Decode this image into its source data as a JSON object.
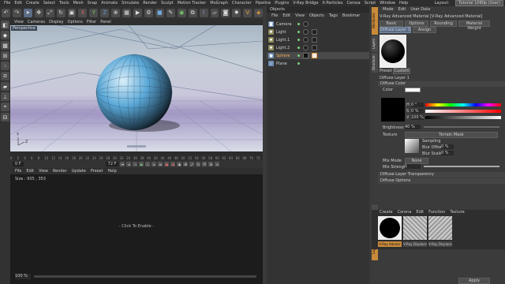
{
  "menubar": {
    "items": [
      "File",
      "Edit",
      "Create",
      "Select",
      "Tools",
      "Mesh",
      "Snap",
      "Animate",
      "Simulate",
      "Render",
      "Sculpt",
      "Motion Tracker",
      "MoGraph",
      "Character",
      "Pipeline",
      "Plugins",
      "V-Ray Bridge",
      "X-Particles",
      "Cerosa",
      "Script",
      "Window",
      "Help"
    ],
    "layout_label": "Layout:",
    "layout_value": "Tutorial 1080p (User)"
  },
  "viewport": {
    "menu": [
      "View",
      "Cameras",
      "Display",
      "Options",
      "Filter",
      "Panel"
    ],
    "label": "Perspective",
    "axis_y": "Y",
    "axis_z": "Z"
  },
  "timeline": {
    "ticks": [
      "0",
      "2",
      "4",
      "6",
      "8",
      "10",
      "12",
      "14",
      "16",
      "18",
      "20",
      "22",
      "24",
      "26",
      "28",
      "30",
      "32",
      "34",
      "36",
      "38",
      "40",
      "42",
      "44",
      "46",
      "48",
      "50",
      "52",
      "54",
      "56",
      "58",
      "60",
      "62",
      "64",
      "66",
      "68",
      "70",
      "72"
    ],
    "frame_start": "0 F",
    "frame_end": "72 F",
    "current": "0 F"
  },
  "picture_viewer": {
    "menu": [
      "File",
      "Edit",
      "View",
      "Render",
      "Update",
      "Preset",
      "Help"
    ],
    "size": "Size : 935 , 353",
    "placeholder": "- Click To Enable -",
    "zoom": "100 %"
  },
  "objects": {
    "title": "Objects",
    "menu": [
      "File",
      "Edit",
      "View",
      "Objects",
      "Tags",
      "Bookmar"
    ],
    "rows": [
      "Camera",
      "Light",
      "Light.1",
      "Light.2",
      "Sphere",
      "Plane"
    ]
  },
  "attributes": {
    "menu": [
      "Mode",
      "Edit",
      "User Data"
    ],
    "header": "V-Ray Advanced Material [V-Ray Advanced Material]",
    "tabs": [
      "Basic",
      "Options",
      "Rounding",
      "Material Weight"
    ],
    "subtabs": [
      "Diffuse Layer 1",
      "Assign"
    ],
    "preset_label": "Preset",
    "preset_value": "Custom",
    "layer_title": "Diffuse Layer 1",
    "diffuse_color": "Diffuse Color",
    "color_label": "Color",
    "h_label": "H",
    "h_value": "0 °",
    "s_label": "S",
    "s_value": "0 %",
    "v_label": "V",
    "v_value": "100 %",
    "brightness_label": "Brightness",
    "brightness_value": "40 %",
    "texture_label": "Texture",
    "texture_value": "Terrain Mask",
    "sampling_label": "Sampling",
    "blur_offset_label": "Blur Offset",
    "blur_offset_value": "0 %",
    "blur_scale_label": "Blur Scale",
    "blur_scale_value": "0 %",
    "mix_mode_label": "Mix Mode",
    "mix_mode_value": "None",
    "mix_strength_label": "Mix Strength",
    "mix_strength_value": "1",
    "section_transparency": "Diffuse Layer Transparency",
    "section_options": "Diffuse Options",
    "materials_menu": [
      "Create",
      "Corona",
      "Edit",
      "Function",
      "Texture"
    ],
    "materials": [
      "V-Ray Advanc",
      "V-Ray Displace",
      "V-Ray Displace"
    ],
    "side_tabs": [
      "Attributes",
      "Layers",
      "Structure",
      "Content Browser"
    ],
    "mat_tabs": [
      "Materials",
      "Layers"
    ],
    "apply": "Apply"
  },
  "colors": {
    "accent": "#c98a3a",
    "sphere": "#5aa8d8",
    "selection": "#5a6c86"
  }
}
